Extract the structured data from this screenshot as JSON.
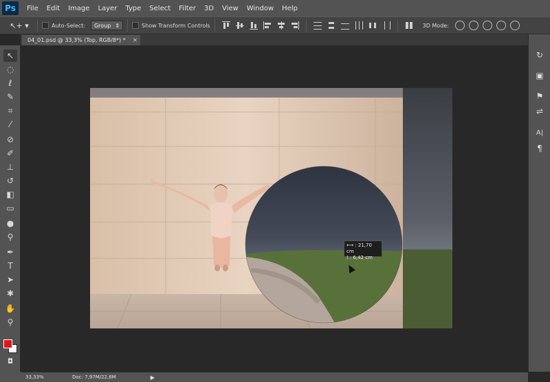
{
  "app": {
    "logo": "Ps",
    "accent": "#49b7ff"
  },
  "menu": [
    "File",
    "Edit",
    "Image",
    "Layer",
    "Type",
    "Select",
    "Filter",
    "3D",
    "View",
    "Window",
    "Help"
  ],
  "options": {
    "tool_glyph": "↖+ ▾",
    "auto_select_label": "Auto-Select:",
    "group_value": "Group",
    "group_arrow": "⇕",
    "transform_label": "Show Transform Controls",
    "mode_3d_label": "3D Mode:"
  },
  "document": {
    "tab_label": "04_01.psd @ 33,3% (Top, RGB/8*) *",
    "close": "×"
  },
  "tools": [
    {
      "name": "move-tool",
      "glyph": "↖"
    },
    {
      "name": "marquee-tool",
      "glyph": "◌"
    },
    {
      "name": "lasso-tool",
      "glyph": "ℓ"
    },
    {
      "name": "quick-select-tool",
      "glyph": "✎"
    },
    {
      "name": "crop-tool",
      "glyph": "⌗"
    },
    {
      "name": "eyedropper-tool",
      "glyph": "⁄"
    },
    {
      "name": "healing-tool",
      "glyph": "⊘"
    },
    {
      "name": "brush-tool",
      "glyph": "✐"
    },
    {
      "name": "stamp-tool",
      "glyph": "⊥"
    },
    {
      "name": "history-brush-tool",
      "glyph": "↺"
    },
    {
      "name": "eraser-tool",
      "glyph": "◧"
    },
    {
      "name": "gradient-tool",
      "glyph": "▭"
    },
    {
      "name": "blur-tool",
      "glyph": "●"
    },
    {
      "name": "dodge-tool",
      "glyph": "⚲"
    },
    {
      "name": "pen-tool",
      "glyph": "✒"
    },
    {
      "name": "type-tool",
      "glyph": "T"
    },
    {
      "name": "path-select-tool",
      "glyph": "➤"
    },
    {
      "name": "shape-tool",
      "glyph": "✱"
    },
    {
      "name": "hand-tool",
      "glyph": "✋"
    },
    {
      "name": "zoom-tool",
      "glyph": "⚲"
    }
  ],
  "colors": {
    "foreground": "#e0141c",
    "background": "#ffffff"
  },
  "dock": [
    {
      "name": "history-panel-icon",
      "glyph": "↻"
    },
    {
      "name": "properties-panel-icon",
      "glyph": "▣"
    },
    {
      "name": "brush-panel-icon",
      "glyph": "⚑"
    },
    {
      "name": "adjustments-panel-icon",
      "glyph": "⇌"
    },
    {
      "name": "character-panel-icon",
      "glyph": "A|"
    },
    {
      "name": "paragraph-panel-icon",
      "glyph": "¶"
    }
  ],
  "measure": {
    "width": "21,70 cm",
    "height": "6,42 cm",
    "width_icon": "⟷ :",
    "height_icon": "⟟ :"
  },
  "status": {
    "zoom": "33,33%",
    "doc": "Doc: 7,97M/22,6M",
    "arrow": "▶"
  }
}
